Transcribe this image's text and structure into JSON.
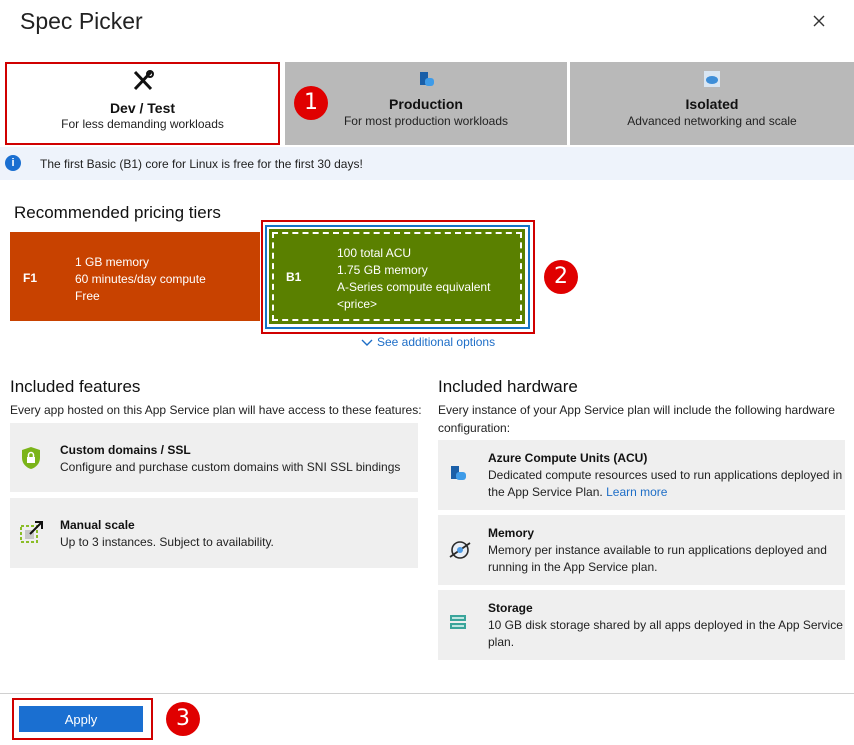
{
  "title": "Spec Picker",
  "tabs": [
    {
      "name": "Dev / Test",
      "desc": "For less demanding workloads"
    },
    {
      "name": "Production",
      "desc": "For most production workloads"
    },
    {
      "name": "Isolated",
      "desc": "Advanced networking and scale"
    }
  ],
  "callouts": [
    "1",
    "2",
    "3"
  ],
  "info": "The first Basic (B1) core for Linux is free for the first 30 days!",
  "recommended": {
    "heading": "Recommended pricing tiers",
    "tiers": [
      {
        "code": "F1",
        "lines": [
          "1 GB memory",
          "60 minutes/day compute",
          "Free"
        ],
        "color": "#c84200"
      },
      {
        "code": "B1",
        "lines": [
          "100 total ACU",
          "1.75 GB memory",
          "A-Series compute equivalent",
          "<price>"
        ],
        "color": "#5a8000"
      }
    ],
    "see_more": "See additional options"
  },
  "features": {
    "heading": "Included features",
    "sub": "Every app hosted on this App Service plan will have access to these features:",
    "items": [
      {
        "title": "Custom domains / SSL",
        "desc": "Configure and purchase custom domains with SNI SSL bindings",
        "icon": "shield-lock-icon"
      },
      {
        "title": "Manual scale",
        "desc": "Up to 3 instances. Subject to availability.",
        "icon": "scale-icon"
      }
    ]
  },
  "hardware": {
    "heading": "Included hardware",
    "sub1": "Every instance of your App Service plan will include the following hardware",
    "sub2": "configuration:",
    "items": [
      {
        "title": "Azure Compute Units (ACU)",
        "desc1": "Dedicated compute resources used to run applications deployed in",
        "desc2": "the App Service Plan.",
        "link": "Learn more",
        "icon": "compute-icon"
      },
      {
        "title": "Memory",
        "desc1": "Memory per instance available to run applications deployed and",
        "desc2": "running in the App Service plan.",
        "icon": "memory-icon"
      },
      {
        "title": "Storage",
        "desc1": "10 GB disk storage shared by all apps deployed in the App Service",
        "desc2": "plan.",
        "icon": "storage-icon"
      }
    ]
  },
  "apply_label": "Apply"
}
